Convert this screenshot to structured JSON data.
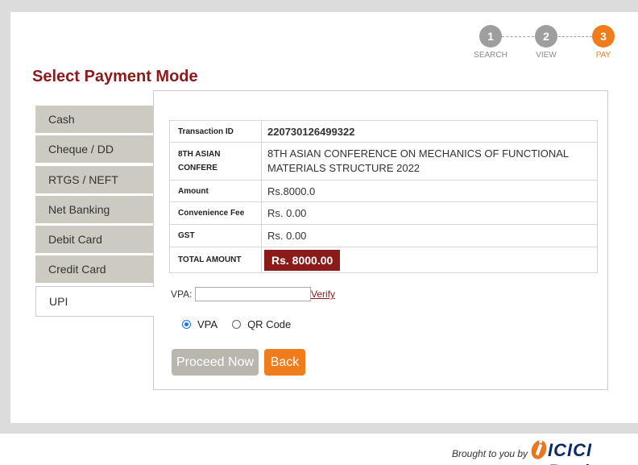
{
  "stepper": {
    "steps": [
      {
        "number": "1",
        "label": "SEARCH",
        "color": "#9e9e9e",
        "label_color": "#8a8a8a"
      },
      {
        "number": "2",
        "label": "VIEW",
        "color": "#9e9e9e",
        "label_color": "#8a8a8a"
      },
      {
        "number": "3",
        "label": "PAY",
        "color": "#f07c1c",
        "label_color": "#f07c1c"
      }
    ]
  },
  "page_title": "Select Payment Mode",
  "tabs": [
    {
      "label": "Cash"
    },
    {
      "label": "Cheque / DD"
    },
    {
      "label": "RTGS / NEFT"
    },
    {
      "label": "Net Banking"
    },
    {
      "label": "Debit Card"
    },
    {
      "label": "Credit Card"
    },
    {
      "label": "UPI",
      "active": true
    }
  ],
  "details": {
    "rows": [
      {
        "key": "Transaction ID",
        "value": "220730126499322"
      },
      {
        "key": "8TH ASIAN CONFERE",
        "value": "8TH ASIAN CONFERENCE ON MECHANICS OF FUNCTIONAL MATERIALS STRUCTURE 2022"
      },
      {
        "key": "Amount",
        "value": "Rs.8000.0"
      },
      {
        "key": "Convenience Fee",
        "value": "Rs. 0.00"
      },
      {
        "key": "GST",
        "value": "Rs. 0.00"
      },
      {
        "key": "TOTAL AMOUNT",
        "value": "Rs. 8000.00"
      }
    ]
  },
  "upi": {
    "vpa_label": "VPA:",
    "vpa_value": "",
    "verify_label": "Verify",
    "options": [
      "VPA",
      "QR Code"
    ],
    "selected": "VPA"
  },
  "buttons": {
    "proceed": "Proceed Now",
    "back": "Back"
  },
  "footer": {
    "brought_by": "Brought to you by",
    "brand": "ICICI Bank"
  },
  "colors": {
    "accent": "#8b1a1a",
    "orange": "#f07c1c",
    "tab_bg": "#cdcbc1"
  }
}
